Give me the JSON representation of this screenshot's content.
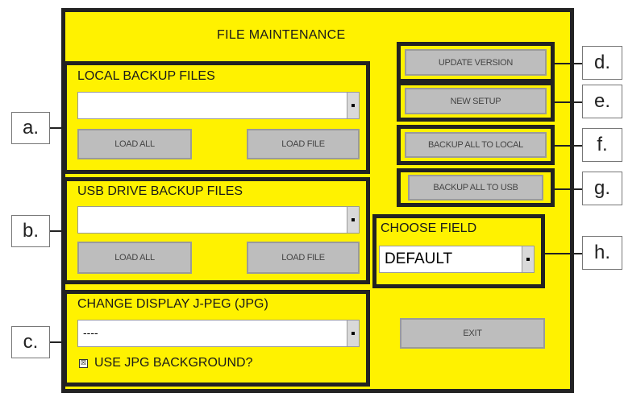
{
  "window": {
    "title": "FILE MAINTENANCE"
  },
  "local_backup": {
    "label": "LOCAL BACKUP FILES",
    "selected": "",
    "load_all": "LOAD ALL",
    "load_file": "LOAD FILE",
    "callout": "a."
  },
  "usb_backup": {
    "label": "USB DRIVE BACKUP FILES",
    "selected": "",
    "load_all": "LOAD ALL",
    "load_file": "LOAD FILE",
    "callout": "b."
  },
  "display_jpeg": {
    "label": "CHANGE DISPLAY J-PEG (JPG)",
    "selected": "----",
    "checkbox_label": "USE JPG BACKGROUND?",
    "checkbox_checked": true,
    "checkbox_mark": "☒",
    "callout": "c."
  },
  "actions": {
    "update_version": "UPDATE VERSION",
    "new_setup": "NEW SETUP",
    "backup_all_local": "BACKUP ALL TO LOCAL",
    "backup_all_usb": "BACKUP ALL TO USB",
    "callout_d": "d.",
    "callout_e": "e.",
    "callout_f": "f.",
    "callout_g": "g."
  },
  "choose_field": {
    "label": "CHOOSE FIELD",
    "selected": "DEFAULT",
    "callout": "h."
  },
  "exit": {
    "label": "EXIT"
  },
  "colors": {
    "panel": "#fff200",
    "border": "#222222",
    "button": "#bdbdbd"
  }
}
